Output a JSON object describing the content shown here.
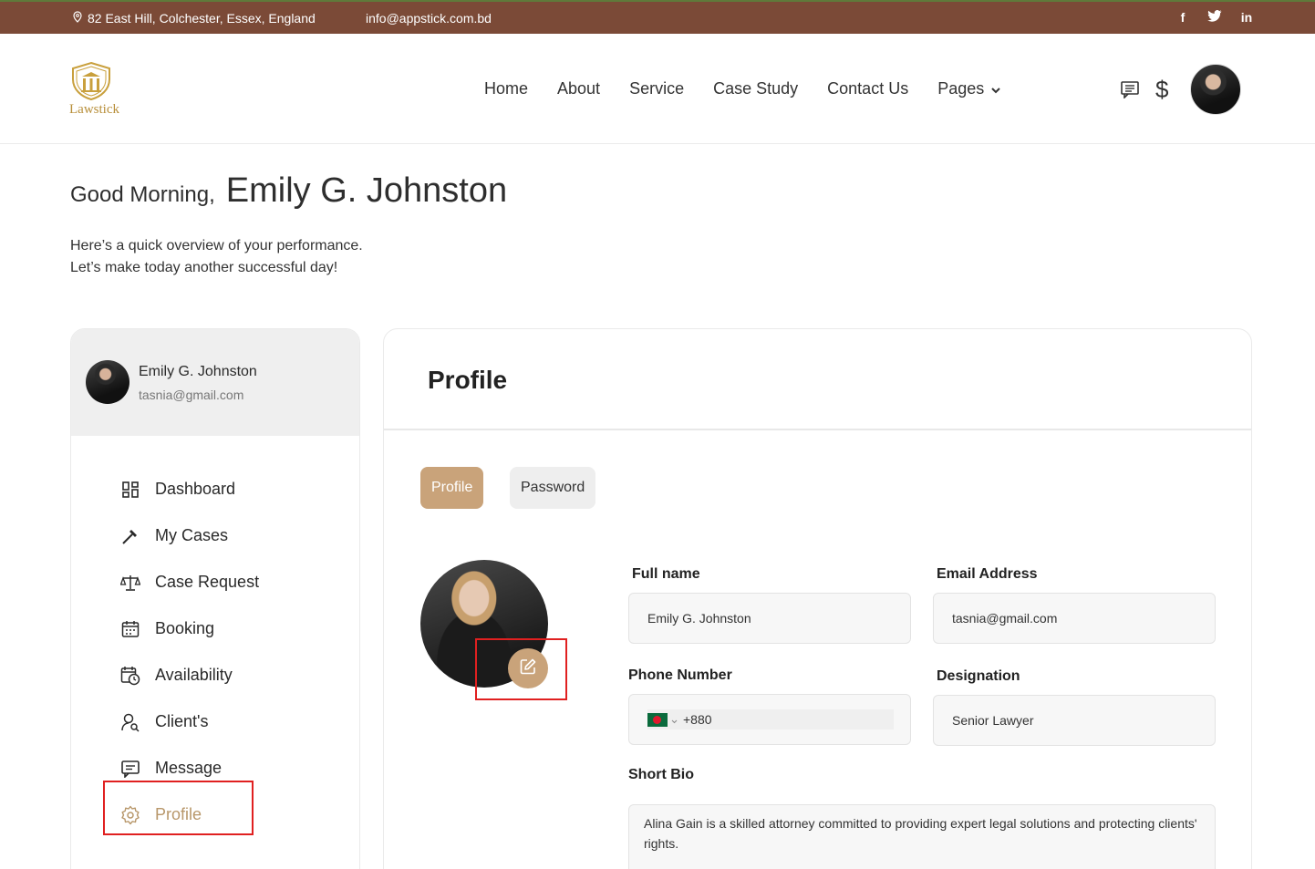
{
  "topbar": {
    "address": "82 East Hill, Colchester, Essex, England",
    "email": "info@appstick.com.bd",
    "social": [
      "f",
      "t",
      "in"
    ]
  },
  "header": {
    "logo_text": "Lawstick",
    "nav": [
      "Home",
      "About",
      "Service",
      "Case Study",
      "Contact Us",
      "Pages"
    ],
    "currency_symbol": "$"
  },
  "greeting": {
    "salutation": "Good Morning,",
    "name": "Emily G. Johnston",
    "line1": "Here’s a quick overview of your performance.",
    "line2": "Let’s make today another successful day!"
  },
  "sidebar": {
    "user_name": "Emily G. Johnston",
    "user_email": "tasnia@gmail.com",
    "items": [
      {
        "label": "Dashboard",
        "icon": "dashboard-icon"
      },
      {
        "label": "My Cases",
        "icon": "hammer-icon"
      },
      {
        "label": "Case Request",
        "icon": "scales-icon"
      },
      {
        "label": "Booking",
        "icon": "calendar-icon"
      },
      {
        "label": "Availability",
        "icon": "calendar-clock-icon"
      },
      {
        "label": "Client's",
        "icon": "user-search-icon"
      },
      {
        "label": "Message",
        "icon": "chat-icon"
      },
      {
        "label": "Profile",
        "icon": "gear-icon"
      }
    ],
    "active_item": "Profile"
  },
  "main": {
    "title": "Profile",
    "tabs": [
      "Profile",
      "Password"
    ],
    "active_tab": "Profile",
    "form": {
      "full_name_label": "Full name",
      "full_name_value": "Emily G. Johnston",
      "email_label": "Email Address",
      "email_value": "tasnia@gmail.com",
      "phone_label": "Phone Number",
      "phone_code": "+880",
      "designation_label": "Designation",
      "designation_value": "Senior Lawyer",
      "bio_label": "Short Bio",
      "bio_value": "Alina Gain is a skilled attorney committed to providing expert legal solutions and protecting clients' rights."
    }
  },
  "colors": {
    "topbar": "#7b4a37",
    "accent": "#c9a37a",
    "highlight": "#e02020"
  }
}
